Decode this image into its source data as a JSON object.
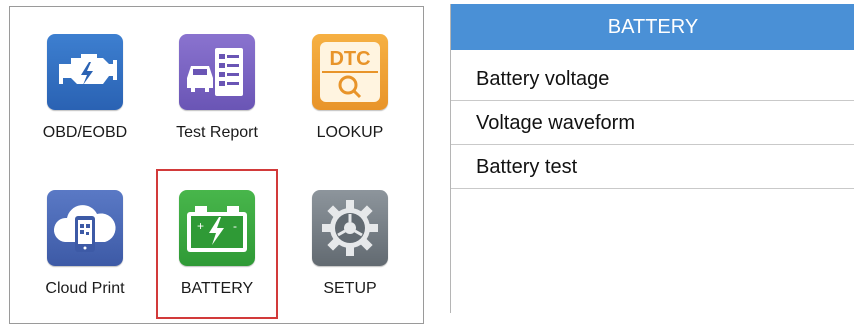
{
  "main_menu": {
    "items": [
      {
        "label": "OBD/EOBD",
        "icon": "engine-icon"
      },
      {
        "label": "Test Report",
        "icon": "report-icon"
      },
      {
        "label": "LOOKUP",
        "icon": "dtc-lookup-icon",
        "icon_text": "DTC"
      },
      {
        "label": "Cloud Print",
        "icon": "cloud-print-icon"
      },
      {
        "label": "BATTERY",
        "icon": "battery-icon",
        "selected": true
      },
      {
        "label": "SETUP",
        "icon": "gear-icon"
      }
    ]
  },
  "battery_screen": {
    "title": "BATTERY",
    "items": [
      {
        "label": "Battery voltage"
      },
      {
        "label": "Voltage waveform"
      },
      {
        "label": "Battery test"
      }
    ]
  },
  "colors": {
    "title_bar": "#4a90d6",
    "selection": "#d23a3a"
  }
}
